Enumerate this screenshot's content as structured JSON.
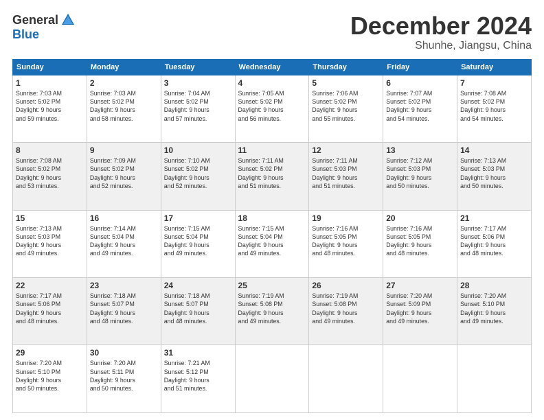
{
  "logo": {
    "general": "General",
    "blue": "Blue"
  },
  "header": {
    "month": "December 2024",
    "location": "Shunhe, Jiangsu, China"
  },
  "weekdays": [
    "Sunday",
    "Monday",
    "Tuesday",
    "Wednesday",
    "Thursday",
    "Friday",
    "Saturday"
  ],
  "weeks": [
    [
      {
        "day": "1",
        "info": "Sunrise: 7:03 AM\nSunset: 5:02 PM\nDaylight: 9 hours\nand 59 minutes."
      },
      {
        "day": "2",
        "info": "Sunrise: 7:03 AM\nSunset: 5:02 PM\nDaylight: 9 hours\nand 58 minutes."
      },
      {
        "day": "3",
        "info": "Sunrise: 7:04 AM\nSunset: 5:02 PM\nDaylight: 9 hours\nand 57 minutes."
      },
      {
        "day": "4",
        "info": "Sunrise: 7:05 AM\nSunset: 5:02 PM\nDaylight: 9 hours\nand 56 minutes."
      },
      {
        "day": "5",
        "info": "Sunrise: 7:06 AM\nSunset: 5:02 PM\nDaylight: 9 hours\nand 55 minutes."
      },
      {
        "day": "6",
        "info": "Sunrise: 7:07 AM\nSunset: 5:02 PM\nDaylight: 9 hours\nand 54 minutes."
      },
      {
        "day": "7",
        "info": "Sunrise: 7:08 AM\nSunset: 5:02 PM\nDaylight: 9 hours\nand 54 minutes."
      }
    ],
    [
      {
        "day": "8",
        "info": "Sunrise: 7:08 AM\nSunset: 5:02 PM\nDaylight: 9 hours\nand 53 minutes."
      },
      {
        "day": "9",
        "info": "Sunrise: 7:09 AM\nSunset: 5:02 PM\nDaylight: 9 hours\nand 52 minutes."
      },
      {
        "day": "10",
        "info": "Sunrise: 7:10 AM\nSunset: 5:02 PM\nDaylight: 9 hours\nand 52 minutes."
      },
      {
        "day": "11",
        "info": "Sunrise: 7:11 AM\nSunset: 5:02 PM\nDaylight: 9 hours\nand 51 minutes."
      },
      {
        "day": "12",
        "info": "Sunrise: 7:11 AM\nSunset: 5:03 PM\nDaylight: 9 hours\nand 51 minutes."
      },
      {
        "day": "13",
        "info": "Sunrise: 7:12 AM\nSunset: 5:03 PM\nDaylight: 9 hours\nand 50 minutes."
      },
      {
        "day": "14",
        "info": "Sunrise: 7:13 AM\nSunset: 5:03 PM\nDaylight: 9 hours\nand 50 minutes."
      }
    ],
    [
      {
        "day": "15",
        "info": "Sunrise: 7:13 AM\nSunset: 5:03 PM\nDaylight: 9 hours\nand 49 minutes."
      },
      {
        "day": "16",
        "info": "Sunrise: 7:14 AM\nSunset: 5:04 PM\nDaylight: 9 hours\nand 49 minutes."
      },
      {
        "day": "17",
        "info": "Sunrise: 7:15 AM\nSunset: 5:04 PM\nDaylight: 9 hours\nand 49 minutes."
      },
      {
        "day": "18",
        "info": "Sunrise: 7:15 AM\nSunset: 5:04 PM\nDaylight: 9 hours\nand 49 minutes."
      },
      {
        "day": "19",
        "info": "Sunrise: 7:16 AM\nSunset: 5:05 PM\nDaylight: 9 hours\nand 48 minutes."
      },
      {
        "day": "20",
        "info": "Sunrise: 7:16 AM\nSunset: 5:05 PM\nDaylight: 9 hours\nand 48 minutes."
      },
      {
        "day": "21",
        "info": "Sunrise: 7:17 AM\nSunset: 5:06 PM\nDaylight: 9 hours\nand 48 minutes."
      }
    ],
    [
      {
        "day": "22",
        "info": "Sunrise: 7:17 AM\nSunset: 5:06 PM\nDaylight: 9 hours\nand 48 minutes."
      },
      {
        "day": "23",
        "info": "Sunrise: 7:18 AM\nSunset: 5:07 PM\nDaylight: 9 hours\nand 48 minutes."
      },
      {
        "day": "24",
        "info": "Sunrise: 7:18 AM\nSunset: 5:07 PM\nDaylight: 9 hours\nand 48 minutes."
      },
      {
        "day": "25",
        "info": "Sunrise: 7:19 AM\nSunset: 5:08 PM\nDaylight: 9 hours\nand 49 minutes."
      },
      {
        "day": "26",
        "info": "Sunrise: 7:19 AM\nSunset: 5:08 PM\nDaylight: 9 hours\nand 49 minutes."
      },
      {
        "day": "27",
        "info": "Sunrise: 7:20 AM\nSunset: 5:09 PM\nDaylight: 9 hours\nand 49 minutes."
      },
      {
        "day": "28",
        "info": "Sunrise: 7:20 AM\nSunset: 5:10 PM\nDaylight: 9 hours\nand 49 minutes."
      }
    ],
    [
      {
        "day": "29",
        "info": "Sunrise: 7:20 AM\nSunset: 5:10 PM\nDaylight: 9 hours\nand 50 minutes."
      },
      {
        "day": "30",
        "info": "Sunrise: 7:20 AM\nSunset: 5:11 PM\nDaylight: 9 hours\nand 50 minutes."
      },
      {
        "day": "31",
        "info": "Sunrise: 7:21 AM\nSunset: 5:12 PM\nDaylight: 9 hours\nand 51 minutes."
      },
      {
        "day": "",
        "info": ""
      },
      {
        "day": "",
        "info": ""
      },
      {
        "day": "",
        "info": ""
      },
      {
        "day": "",
        "info": ""
      }
    ]
  ]
}
